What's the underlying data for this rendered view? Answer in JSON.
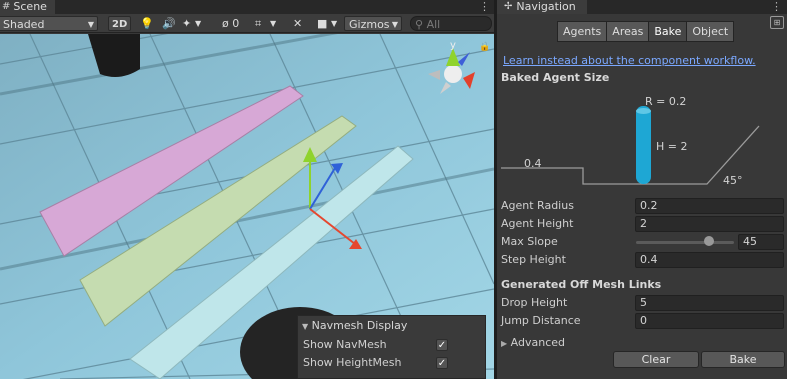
{
  "scene": {
    "tab_label": "Scene",
    "toolbar": {
      "shading_mode": "Shaded",
      "mode_2d": "2D",
      "hidden_count": "0",
      "gizmos_label": "Gizmos",
      "search_placeholder": "All"
    },
    "navmesh_overlay": {
      "title": "Navmesh Display",
      "show_navmesh_label": "Show NavMesh",
      "show_navmesh_checked": true,
      "show_heightmesh_label": "Show HeightMesh",
      "show_heightmesh_checked": true
    },
    "gizmo": {
      "y_label": "y"
    },
    "colors": {
      "plane_pink": "#d7a8d6",
      "plane_green": "#c5dcb0",
      "plane_cyan": "#bfe6ea",
      "floor": "#8cc2d6"
    }
  },
  "navigation": {
    "tab_label": "Navigation",
    "tabs": [
      {
        "label": "Agents",
        "active": false
      },
      {
        "label": "Areas",
        "active": false
      },
      {
        "label": "Bake",
        "active": true
      },
      {
        "label": "Object",
        "active": false
      }
    ],
    "workflow_link": "Learn instead about the component workflow.",
    "baked_agent_size_header": "Baked Agent Size",
    "diagram": {
      "radius_label": "R = 0.2",
      "height_label": "H = 2",
      "step_label": "0.4",
      "slope_label": "45°",
      "agent_color": "#1ea7d4"
    },
    "fields": [
      {
        "label": "Agent Radius",
        "value": "0.2"
      },
      {
        "label": "Agent Height",
        "value": "2"
      }
    ],
    "max_slope": {
      "label": "Max Slope",
      "value": "45",
      "slider_fraction": 0.5
    },
    "step_height": {
      "label": "Step Height",
      "value": "0.4"
    },
    "offmesh_header": "Generated Off Mesh Links",
    "offmesh_fields": [
      {
        "label": "Drop Height",
        "value": "5"
      },
      {
        "label": "Jump Distance",
        "value": "0"
      }
    ],
    "advanced_label": "Advanced",
    "clear_button": "Clear",
    "bake_button": "Bake"
  }
}
